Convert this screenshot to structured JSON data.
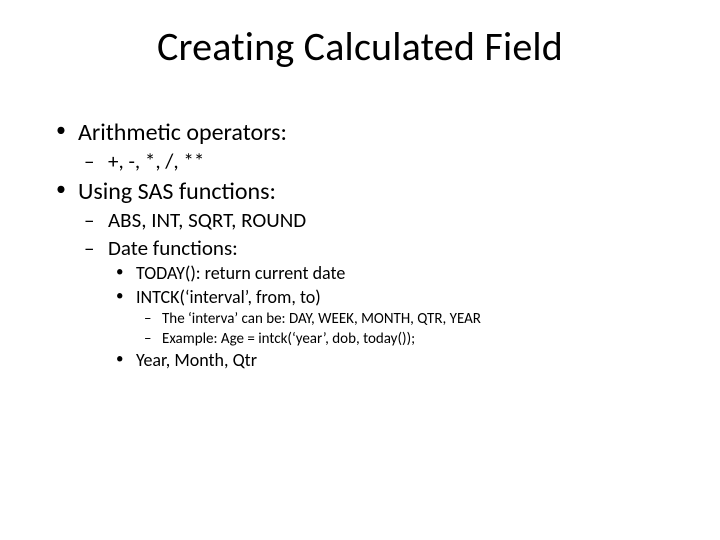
{
  "title": "Creating Calculated Field",
  "b1": "Arithmetic operators:",
  "b1_1": " +, -, *, /, **",
  "b2": "Using SAS functions:",
  "b2_1": "ABS, INT, SQRT, ROUND",
  "b2_2": "Date functions:",
  "b2_2_1": "TODAY(): return current date",
  "b2_2_2": "INTCK(‘interval’, from, to)",
  "b2_2_2_1": "The ‘interva’ can be: DAY, WEEK, MONTH, QTR, YEAR",
  "b2_2_2_2": "Example: Age = intck(‘year’, dob, today());",
  "b2_2_3": "Year, Month, Qtr"
}
